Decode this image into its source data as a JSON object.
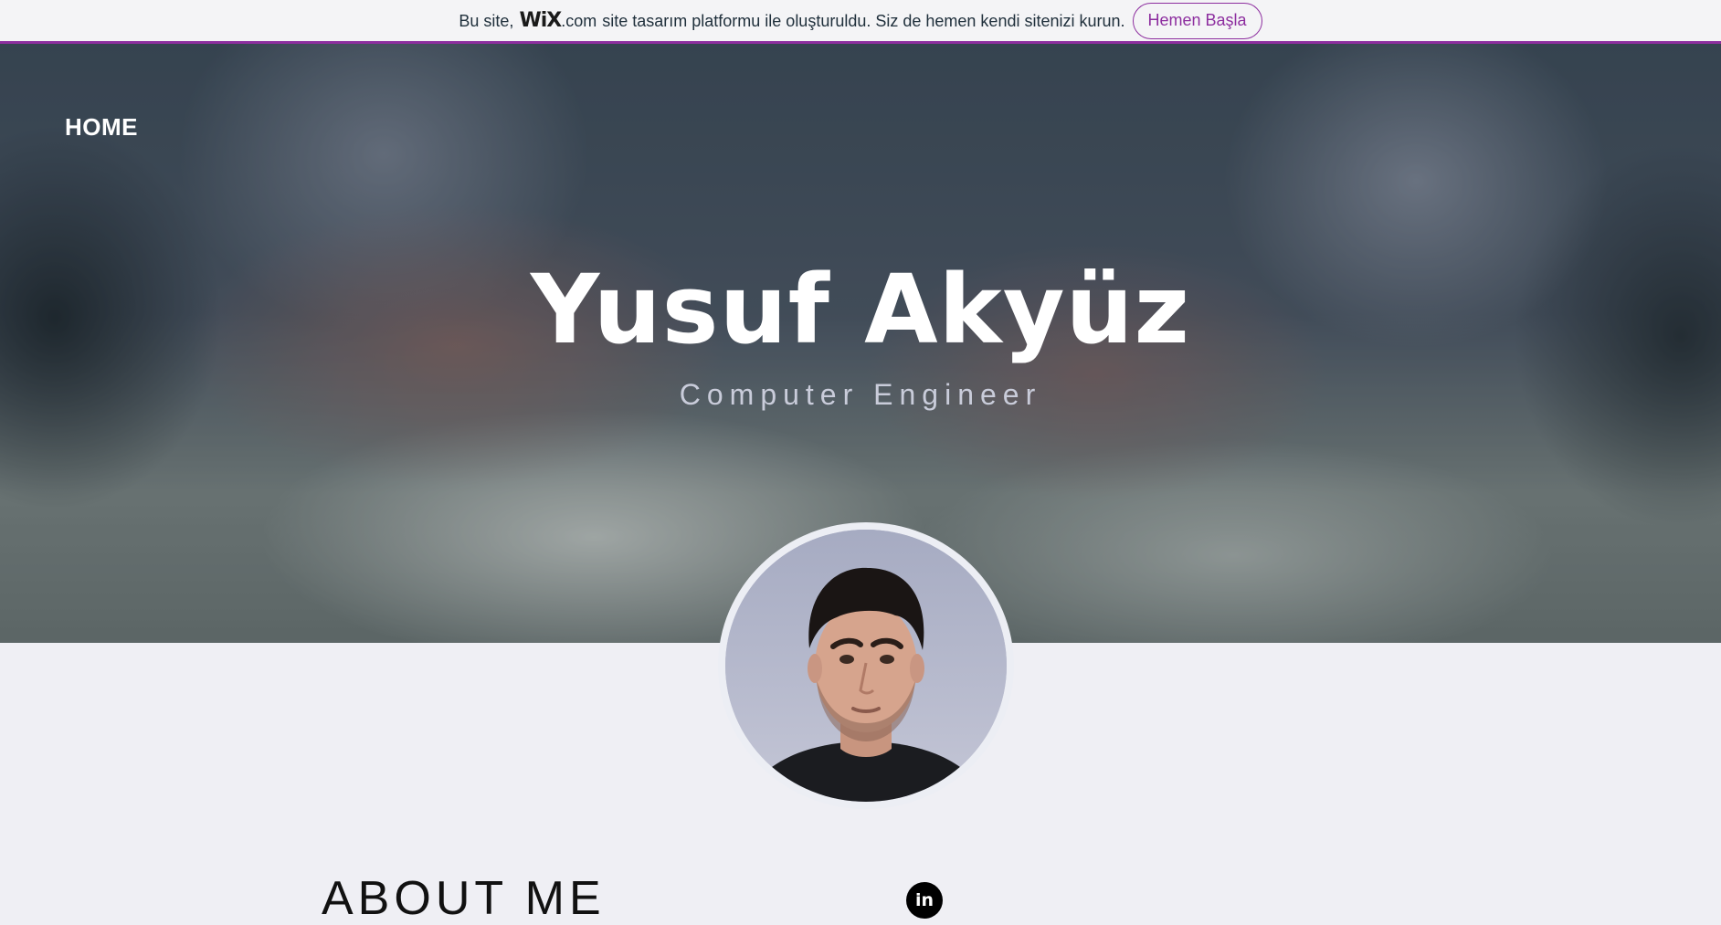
{
  "banner": {
    "text_before": "Bu site,",
    "logo": "WiX",
    "logo_suffix": ".com",
    "text_after": "site tasarım platformu ile oluşturuldu. Siz de hemen kendi sitenizi kurun.",
    "cta_label": "Hemen Başla",
    "accent_color": "#8d2e9f"
  },
  "nav": {
    "home_label": "HOME"
  },
  "hero": {
    "title": "Yusuf Akyüz",
    "subtitle": "Computer Engineer"
  },
  "profile": {
    "photo_icon": "person-photo"
  },
  "about": {
    "title": "ABOUT ME",
    "social_icon": "linkedin-icon",
    "social_glyph": "in"
  }
}
